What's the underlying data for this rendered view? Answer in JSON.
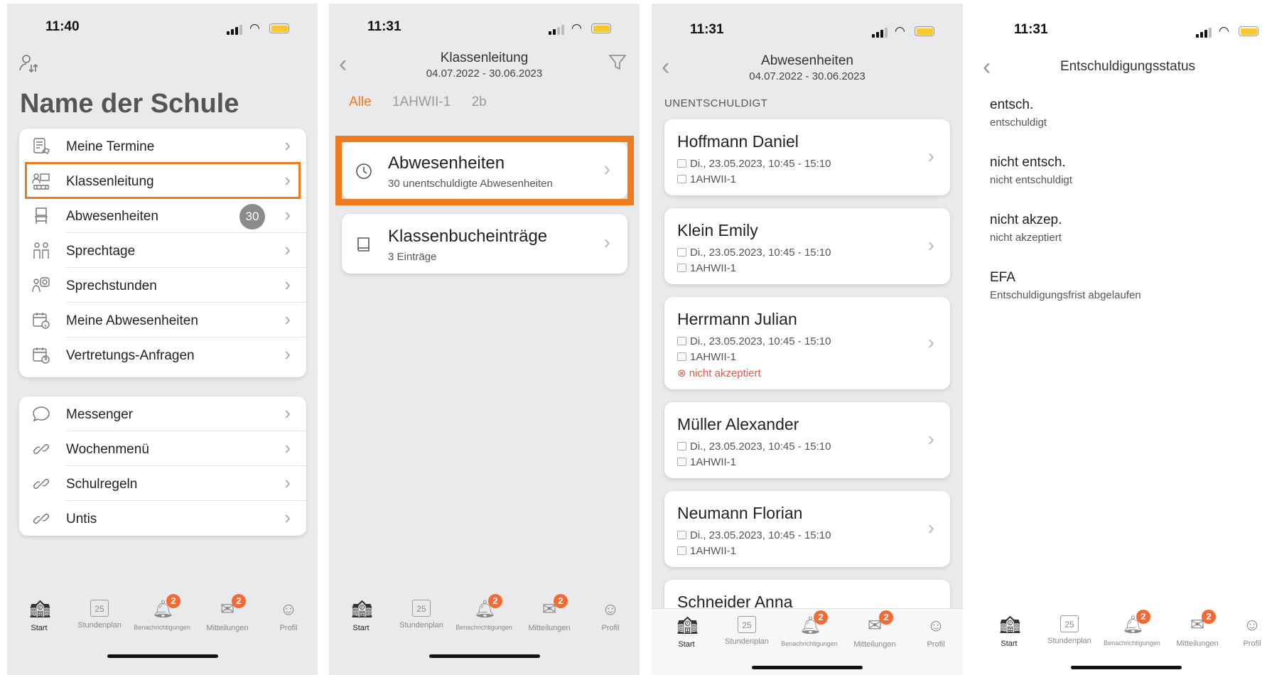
{
  "colors": {
    "accent": "#f07b1e",
    "badge": "#f26b35",
    "rejected": "#e4564a"
  },
  "tabs": [
    {
      "label": "Start",
      "icon": "school-icon"
    },
    {
      "label": "Stundenplan",
      "icon": "calendar-icon",
      "calendar_day": "25"
    },
    {
      "label": "Benachrichtigungen",
      "icon": "bell-icon",
      "badge": "2"
    },
    {
      "label": "Mitteilungen",
      "icon": "mail-icon",
      "badge": "2"
    },
    {
      "label": "Profil",
      "icon": "person-icon"
    }
  ],
  "screen1": {
    "time": "11:40",
    "title": "Name der Schule",
    "menu1": [
      {
        "label": "Meine Termine",
        "icon": "document-icon"
      },
      {
        "label": "Klassenleitung",
        "icon": "class-icon"
      },
      {
        "label": "Abwesenheiten",
        "icon": "chair-icon",
        "badge": "30"
      },
      {
        "label": "Sprechtage",
        "icon": "people-icon"
      },
      {
        "label": "Sprechstunden",
        "icon": "consultation-icon"
      },
      {
        "label": "Meine Abwesenheiten",
        "icon": "calendar-info-icon"
      },
      {
        "label": "Vertretungs-Anfragen",
        "icon": "calendar-question-icon"
      }
    ],
    "menu2": [
      {
        "label": "Messenger",
        "icon": "chat-icon"
      },
      {
        "label": "Wochenmenü",
        "icon": "link-icon"
      },
      {
        "label": "Schulregeln",
        "icon": "link-icon"
      },
      {
        "label": "Untis",
        "icon": "link-icon"
      }
    ]
  },
  "screen2": {
    "time": "11:31",
    "title": "Klassenleitung",
    "date_range": "04.07.2022 - 30.06.2023",
    "segments": [
      "Alle",
      "1AHWII-1",
      "2b"
    ],
    "items": [
      {
        "title": "Abwesenheiten",
        "subtitle": "30 unentschuldigte Abwesenheiten",
        "icon": "clock-icon"
      },
      {
        "title": "Klassenbucheinträge",
        "subtitle": "3 Einträge",
        "icon": "book-icon"
      }
    ]
  },
  "screen3": {
    "time": "11:31",
    "title": "Abwesenheiten",
    "date_range": "04.07.2022 - 30.06.2023",
    "section": "UNENTSCHULDIGT",
    "absences": [
      {
        "name": "Hoffmann Daniel",
        "date": "Di., 23.05.2023, 10:45 - 15:10",
        "class": "1AHWII-1"
      },
      {
        "name": "Klein Emily",
        "date": "Di., 23.05.2023, 10:45 - 15:10",
        "class": "1AHWII-1"
      },
      {
        "name": "Herrmann Julian",
        "date": "Di., 23.05.2023, 10:45 - 15:10",
        "class": "1AHWII-1",
        "status": "nicht akzeptiert"
      },
      {
        "name": "Müller Alexander",
        "date": "Di., 23.05.2023, 10:45 - 15:10",
        "class": "1AHWII-1"
      },
      {
        "name": "Neumann Florian",
        "date": "Di., 23.05.2023, 10:45 - 15:10",
        "class": "1AHWII-1"
      },
      {
        "name": "Schneider Anna"
      }
    ]
  },
  "screen4": {
    "time": "11:31",
    "title": "Entschuldigungsstatus",
    "statuses": [
      {
        "key": "entsch.",
        "value": "entschuldigt"
      },
      {
        "key": "nicht entsch.",
        "value": "nicht entschuldigt"
      },
      {
        "key": "nicht akzep.",
        "value": "nicht akzeptiert"
      },
      {
        "key": "EFA",
        "value": "Entschuldigungsfrist abgelaufen"
      }
    ]
  }
}
